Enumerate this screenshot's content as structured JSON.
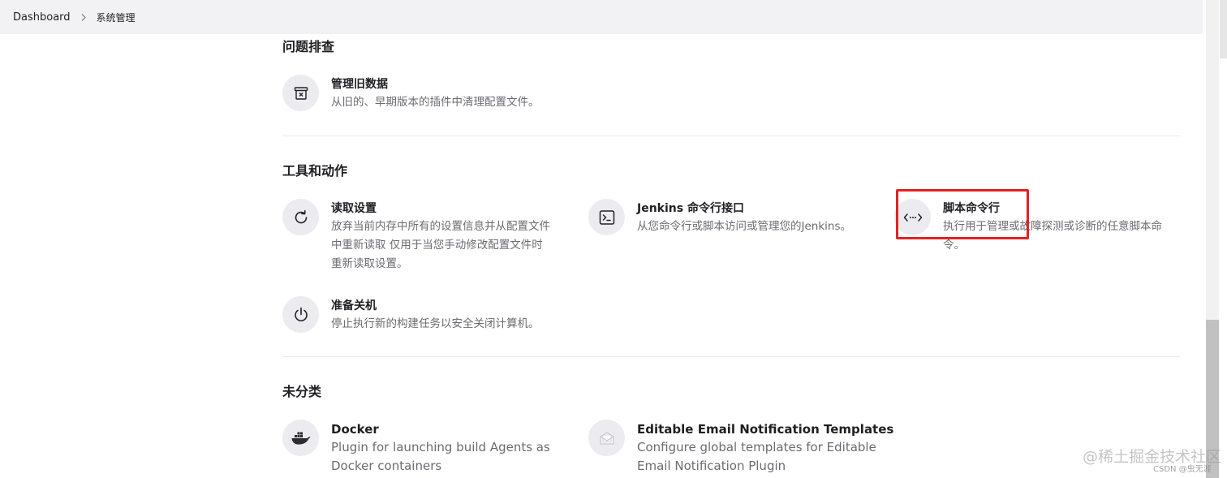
{
  "breadcrumb": {
    "home": "Dashboard",
    "current": "系统管理"
  },
  "sections": {
    "troubleshooting": {
      "title": "问题排查",
      "items": [
        {
          "title": "管理旧数据",
          "desc": "从旧的、早期版本的插件中清理配置文件。",
          "icon": "archive-x-icon"
        }
      ]
    },
    "tools": {
      "title": "工具和动作",
      "items": [
        {
          "title": "读取设置",
          "desc_lines": [
            "放弃当前内存中所有的设置信息并从配置文件",
            "中重新读取 仅用于当您手动修改配置文件时",
            "重新读取设置。"
          ],
          "icon": "reload-icon"
        },
        {
          "title": "Jenkins 命令行接口",
          "desc": "从您命令行或脚本访问或管理您的Jenkins。",
          "icon": "terminal-icon"
        },
        {
          "title": "脚本命令行",
          "desc_lines": [
            "执行用于管理或故障探测或诊断的任意脚本命",
            "令。"
          ],
          "icon": "code-icon"
        },
        {
          "title": "准备关机",
          "desc": "停止执行新的构建任务以安全关闭计算机。",
          "icon": "power-icon"
        }
      ]
    },
    "uncategorized": {
      "title": "未分类",
      "items": [
        {
          "title": "Docker",
          "desc_lines": [
            "Plugin for launching build Agents as",
            "Docker containers"
          ],
          "icon": "docker-whale-icon"
        },
        {
          "title": "Editable Email Notification Templates",
          "desc_lines": [
            "Configure global templates for Editable",
            "Email Notification Plugin"
          ],
          "icon": "email-template-icon"
        }
      ]
    }
  },
  "watermark": {
    "main": "@稀土掘金技术社区",
    "sub": "CSDN @虫无涯"
  },
  "colors": {
    "highlight": "#e32222",
    "topbar": "#f2f2f4",
    "icon_bg": "#ececf0"
  }
}
